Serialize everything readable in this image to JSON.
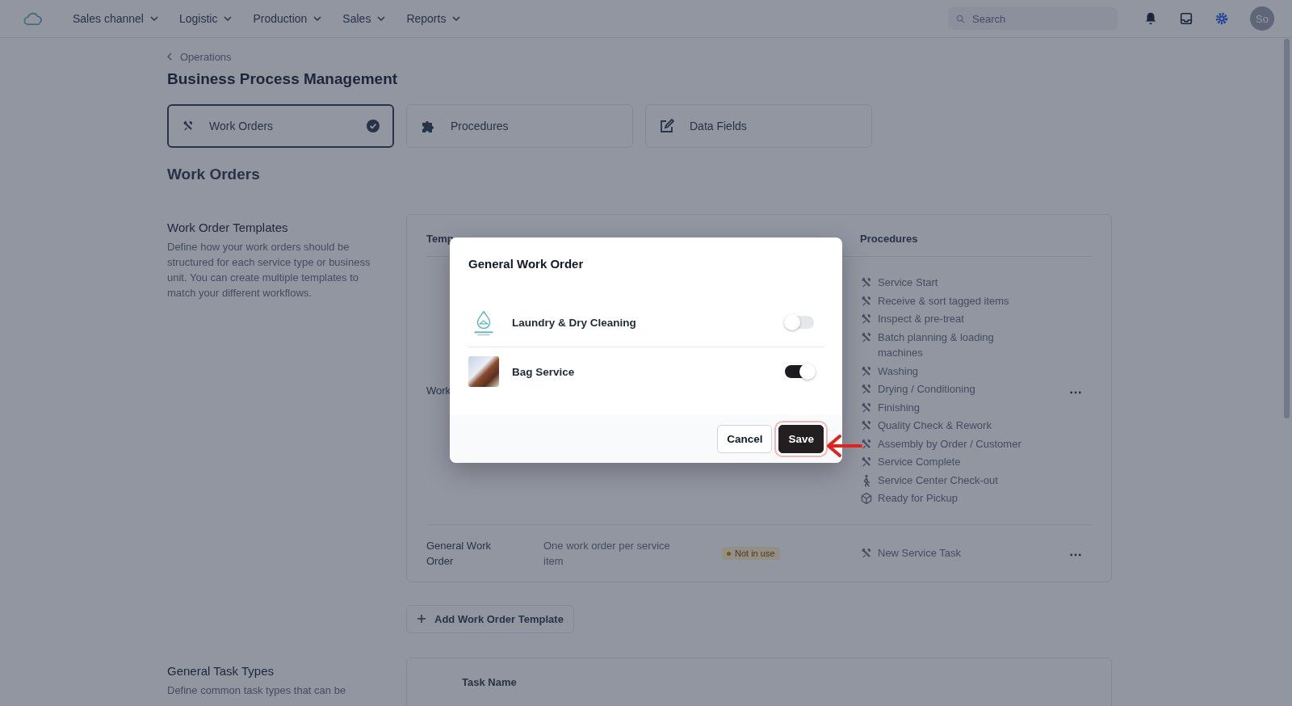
{
  "nav": {
    "items": [
      "Sales channel",
      "Logistic",
      "Production",
      "Sales",
      "Reports"
    ],
    "search": {
      "placeholder": "Search"
    },
    "avatar": "So"
  },
  "breadcrumb": "Operations",
  "title": "Business Process Management",
  "tabs": [
    {
      "label": "Work Orders",
      "kind": "tools",
      "selected": true
    },
    {
      "label": "Procedures",
      "kind": "puzzle",
      "selected": false
    },
    {
      "label": "Data Fields",
      "kind": "edit",
      "selected": false
    }
  ],
  "section_title": "Work Orders",
  "templates": {
    "title": "Work Order Templates",
    "description": "Define how your work orders should be structured for each service type or business unit. You can create multiple templates to match your different workflows.",
    "columns": [
      "Temp",
      "Procedures"
    ],
    "rows": [
      {
        "name": "Work",
        "procedures": [
          {
            "label": "Service Start",
            "kind": "tools"
          },
          {
            "label": "Receive & sort tagged items",
            "kind": "tools"
          },
          {
            "label": "Inspect & pre-treat",
            "kind": "tools"
          },
          {
            "label": "Batch planning & loading machines",
            "kind": "tools"
          },
          {
            "label": "Washing",
            "kind": "tools"
          },
          {
            "label": "Drying / Conditioning",
            "kind": "tools"
          },
          {
            "label": "Finishing",
            "kind": "tools"
          },
          {
            "label": "Quality Check & Rework",
            "kind": "tools"
          },
          {
            "label": "Assembly by Order / Customer",
            "kind": "tools"
          },
          {
            "label": "Service Complete",
            "kind": "tools"
          },
          {
            "label": "Service Center Check-out",
            "kind": "walker"
          },
          {
            "label": "Ready for Pickup",
            "kind": "box"
          }
        ]
      },
      {
        "name": "General Work Order",
        "description": "One work order per service item",
        "status": "Not in use",
        "procedures": [
          {
            "label": "New Service Task",
            "kind": "tools"
          }
        ]
      }
    ],
    "add_button": "Add Work Order Template"
  },
  "task_types": {
    "title": "General Task Types",
    "description": "Define common task types that can be",
    "columns": [
      "Task Name"
    ]
  },
  "modal": {
    "title": "General Work Order",
    "items": [
      {
        "label": "Laundry & Dry Cleaning",
        "kind": "logo",
        "on": false
      },
      {
        "label": "Bag Service",
        "kind": "photo",
        "on": true
      }
    ],
    "buttons": [
      "Cancel",
      "Save"
    ]
  }
}
